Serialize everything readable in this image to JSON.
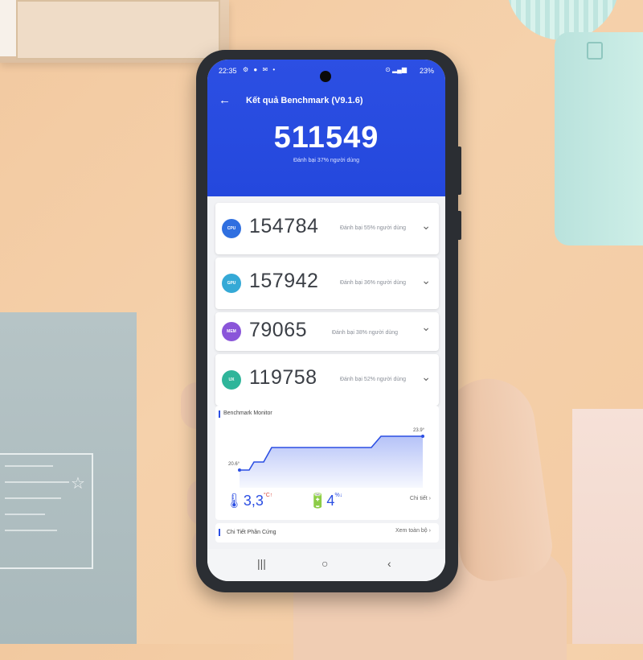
{
  "status_bar": {
    "time": "22:35",
    "left_icons": "⚙ ● ✉ •",
    "signal": "⊙ ▂▄▆",
    "battery": "23%"
  },
  "header": {
    "title": "Kết quả Benchmark (V9.1.6)",
    "total_score": "511549",
    "beat_text": "Đánh bại 37% người dùng"
  },
  "scores": [
    {
      "badge": "CPU",
      "value": "154784",
      "beat": "Đánh bại 55% người dùng",
      "color": "#2f6fe0"
    },
    {
      "badge": "GPU",
      "value": "157942",
      "beat": "Đánh bại 36% người dùng",
      "color": "#35a9d6"
    },
    {
      "badge": "MEM",
      "value": "79065",
      "beat": "Đánh bại 38% người dùng",
      "color": "#8a55d9"
    },
    {
      "badge": "UX",
      "value": "119758",
      "beat": "Đánh bại 52% người dùng",
      "color": "#2fb59a"
    }
  ],
  "monitor": {
    "label": "Benchmark Monitor",
    "start_temp": "20.6°",
    "end_temp": "23.9°",
    "temp_rise": "3,3",
    "temp_unit": "°C↑",
    "battery_drop": "4",
    "battery_unit": "%↓",
    "detail_label": "Chi tiết"
  },
  "hardware": {
    "label": "Chi Tiết Phần Cứng",
    "view_all": "Xem toàn bộ"
  },
  "nav": {
    "recent": "|||",
    "home": "○",
    "back": "‹"
  },
  "colors": {
    "accent": "#2c4fe3"
  }
}
